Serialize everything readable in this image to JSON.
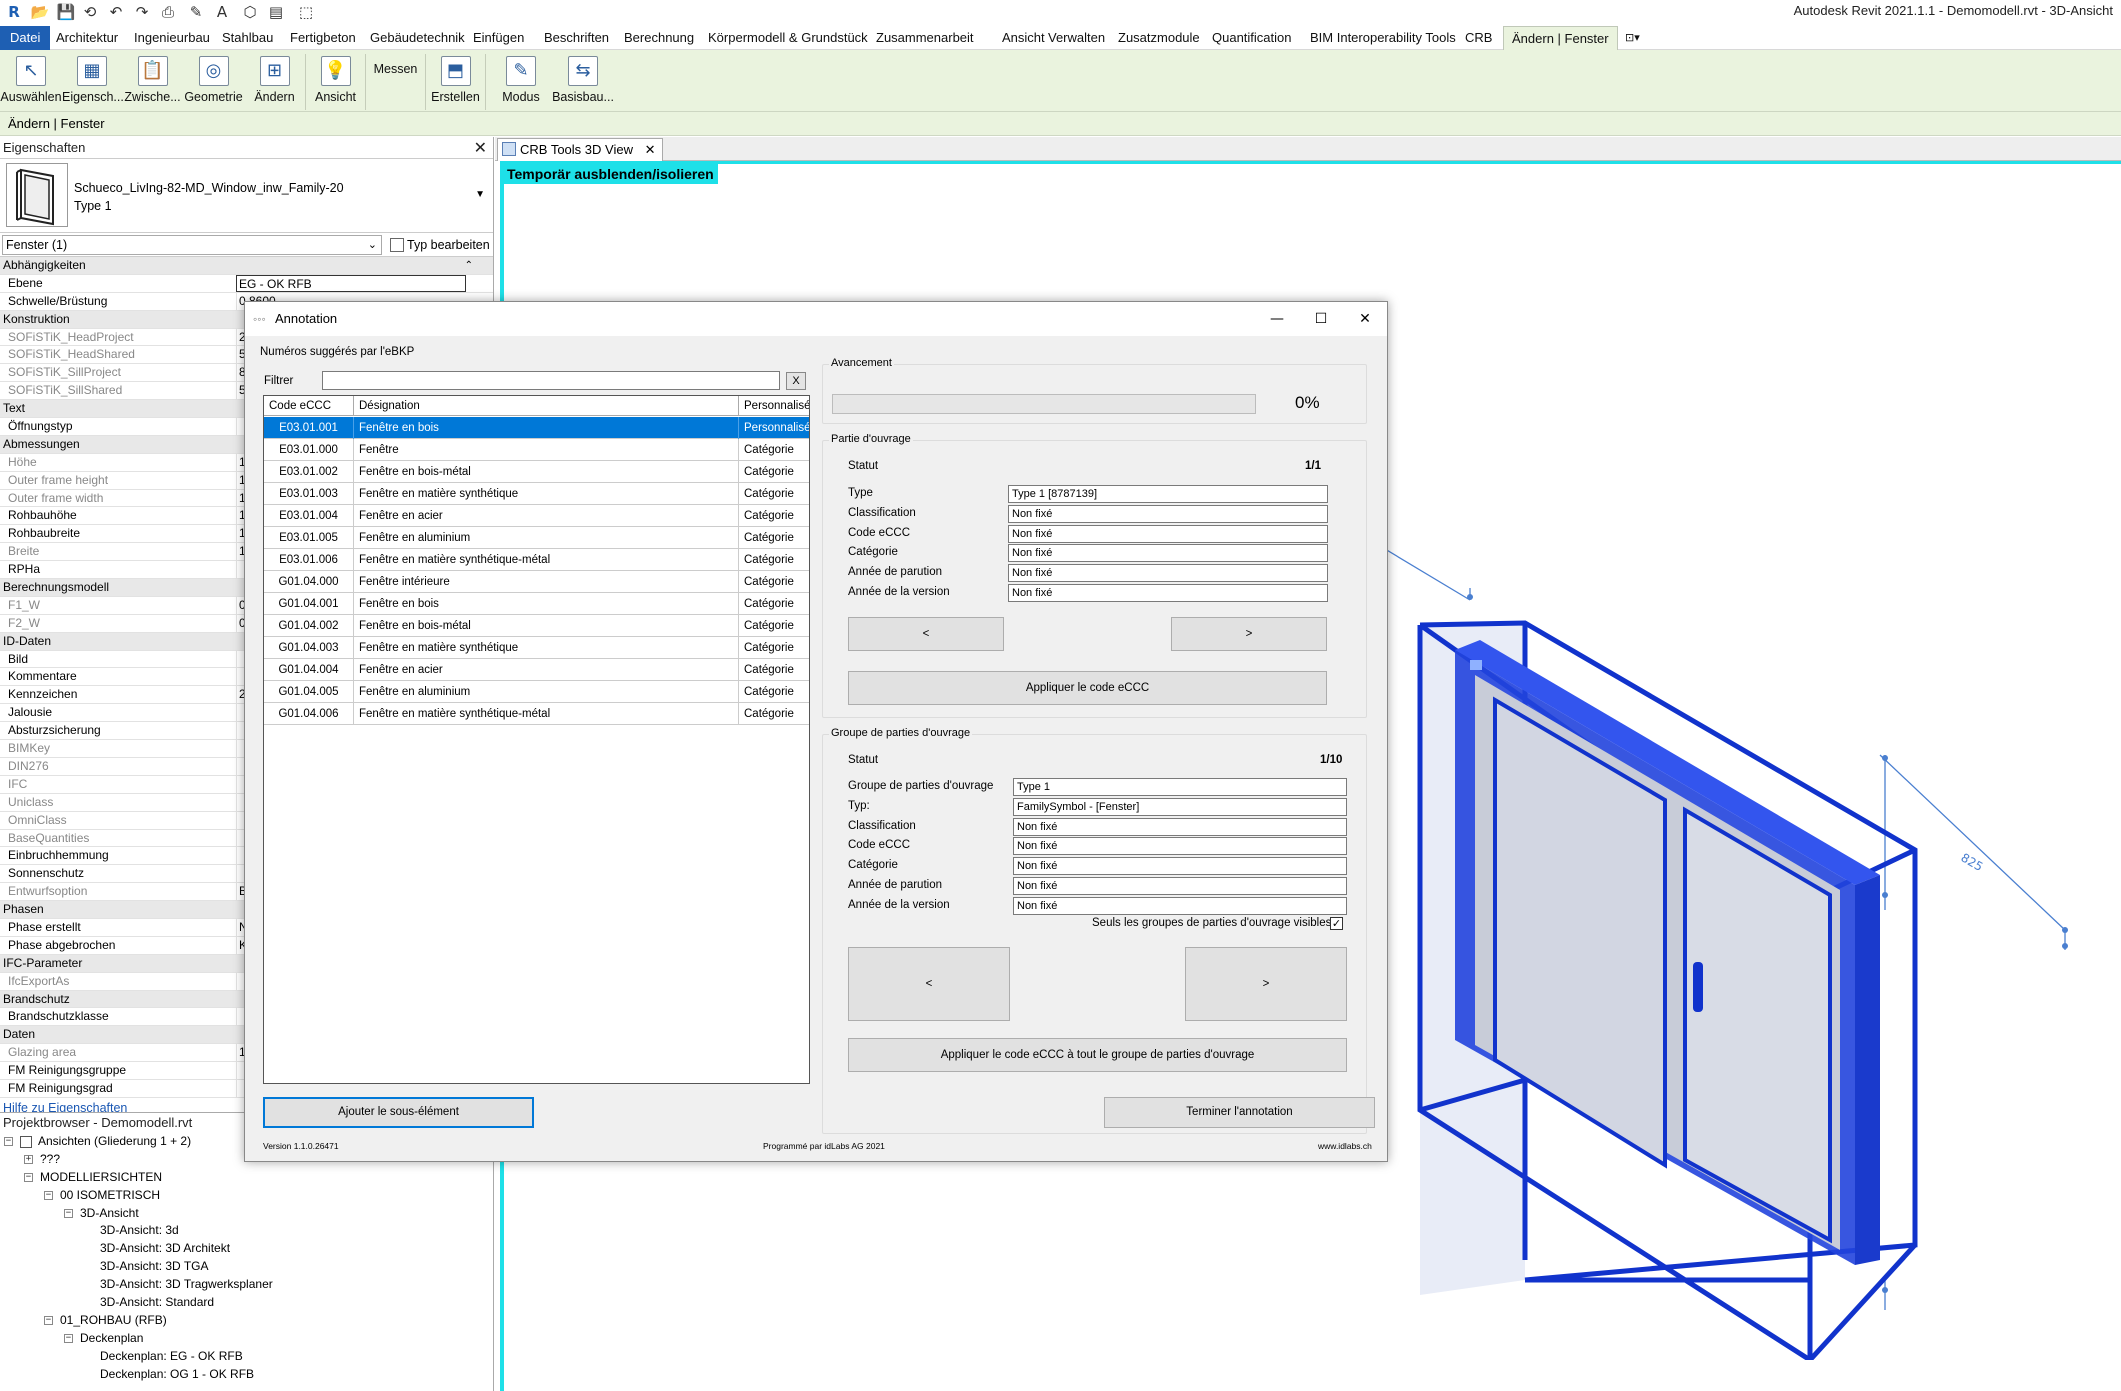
{
  "app": {
    "title": "Autodesk Revit 2021.1.1 - Demomodell.rvt - 3D-Ansicht"
  },
  "quick_access": [
    "R",
    "📂",
    "💾",
    "⟲",
    "↶",
    "↷",
    "⎙",
    "✎",
    "A",
    "⬡",
    "▤",
    "⬚"
  ],
  "ribbon_tabs": [
    {
      "label": "Datei"
    },
    {
      "label": "Architektur"
    },
    {
      "label": "Ingenieurbau"
    },
    {
      "label": "Stahlbau"
    },
    {
      "label": "Fertigbeton"
    },
    {
      "label": "Gebäudetechnik"
    },
    {
      "label": "Einfügen"
    },
    {
      "label": "Beschriften"
    },
    {
      "label": "Berechnung"
    },
    {
      "label": "Körpermodell & Grundstück"
    },
    {
      "label": "Zusammenarbeit"
    },
    {
      "label": "Ansicht"
    },
    {
      "label": "Verwalten"
    },
    {
      "label": "Zusatzmodule"
    },
    {
      "label": "Quantification"
    },
    {
      "label": "BIM Interoperability Tools"
    },
    {
      "label": "CRB"
    },
    {
      "label": "Ändern | Fenster"
    }
  ],
  "ribbon_buttons": [
    {
      "label": "Auswählen",
      "icon": "cursor-icon",
      "glyph": "↖"
    },
    {
      "label": "Eigensch...",
      "icon": "properties-icon",
      "glyph": "▦"
    },
    {
      "label": "Zwische...",
      "icon": "clipboard-icon",
      "glyph": "📋"
    },
    {
      "label": "Geometrie",
      "icon": "geometry-icon",
      "glyph": "◎"
    },
    {
      "label": "Ändern",
      "icon": "modify-icon",
      "glyph": "⊞"
    },
    {
      "label": "Ansicht",
      "icon": "lightbulb-icon",
      "glyph": "💡"
    },
    {
      "label": "Messen",
      "icon": "measure-icon",
      "glyph": ""
    },
    {
      "label": "Erstellen",
      "icon": "create-icon",
      "glyph": "⬒"
    },
    {
      "label": "Modus",
      "icon": "edit-mode-icon",
      "glyph": "✎"
    },
    {
      "label": "Basisbau...",
      "icon": "host-icon",
      "glyph": "⇆"
    }
  ],
  "context_bar": "Ändern | Fenster",
  "properties": {
    "title": "Eigenschaften",
    "type_name": "Schueco_LivIng-82-MD_Window_inw_Family-20",
    "type_sub": "Type 1",
    "filter": "Fenster (1)",
    "edit_type": "Typ bearbeiten",
    "rows": [
      {
        "label": "Abhängigkeiten",
        "group": true,
        "value": "",
        "collapse": "⌃"
      },
      {
        "label": "Ebene",
        "value": "EG - OK RFB",
        "edit": true
      },
      {
        "label": "Schwelle/Brüstung",
        "value": "0,8600"
      },
      {
        "label": "Konstruktion",
        "group": true,
        "value": ""
      },
      {
        "label": "SOFiSTiK_HeadProject",
        "dis": true,
        "value": "2"
      },
      {
        "label": "SOFiSTiK_HeadShared",
        "dis": true,
        "value": "5"
      },
      {
        "label": "SOFiSTiK_SillProject",
        "dis": true,
        "value": "8"
      },
      {
        "label": "SOFiSTiK_SillShared",
        "dis": true,
        "value": "5"
      },
      {
        "label": "Text",
        "group": true,
        "value": ""
      },
      {
        "label": "Öffnungstyp",
        "value": ""
      },
      {
        "label": "Abmessungen",
        "group": true,
        "value": ""
      },
      {
        "label": "Höhe",
        "dis": true,
        "value": "1"
      },
      {
        "label": "Outer frame height",
        "dis": true,
        "value": "1"
      },
      {
        "label": "Outer frame width",
        "dis": true,
        "value": "1"
      },
      {
        "label": "Rohbauhöhe",
        "value": "1"
      },
      {
        "label": "Rohbaubreite",
        "value": "1"
      },
      {
        "label": "Breite",
        "dis": true,
        "value": "1"
      },
      {
        "label": "RPHa",
        "value": ""
      },
      {
        "label": "Berechnungsmodell",
        "group": true,
        "value": ""
      },
      {
        "label": "F1_W",
        "dis": true,
        "value": "0"
      },
      {
        "label": "F2_W",
        "dis": true,
        "value": "0"
      },
      {
        "label": "ID-Daten",
        "group": true,
        "value": ""
      },
      {
        "label": "Bild",
        "value": ""
      },
      {
        "label": "Kommentare",
        "value": ""
      },
      {
        "label": "Kennzeichen",
        "value": "2"
      },
      {
        "label": "Jalousie",
        "value": ""
      },
      {
        "label": "Absturzsicherung",
        "value": ""
      },
      {
        "label": "BIMKey",
        "dis": true,
        "value": ""
      },
      {
        "label": "DIN276",
        "dis": true,
        "value": ""
      },
      {
        "label": "IFC",
        "dis": true,
        "value": ""
      },
      {
        "label": "Uniclass",
        "dis": true,
        "value": ""
      },
      {
        "label": "OmniClass",
        "dis": true,
        "value": ""
      },
      {
        "label": "BaseQuantities",
        "dis": true,
        "value": ""
      },
      {
        "label": "Einbruchhemmung",
        "value": ""
      },
      {
        "label": "Sonnenschutz",
        "value": ""
      },
      {
        "label": "Entwurfsoption",
        "dis": true,
        "value": "B"
      },
      {
        "label": "Phasen",
        "group": true,
        "value": ""
      },
      {
        "label": "Phase erstellt",
        "value": "N"
      },
      {
        "label": "Phase abgebrochen",
        "value": "K"
      },
      {
        "label": "IFC-Parameter",
        "group": true,
        "value": ""
      },
      {
        "label": "IfcExportAs",
        "dis": true,
        "value": ""
      },
      {
        "label": "Brandschutz",
        "group": true,
        "value": ""
      },
      {
        "label": "Brandschutzklasse",
        "value": ""
      },
      {
        "label": "Daten",
        "group": true,
        "value": ""
      },
      {
        "label": "Glazing area",
        "dis": true,
        "value": "1"
      },
      {
        "label": "FM Reinigungsgruppe",
        "value": ""
      },
      {
        "label": "FM Reinigungsgrad",
        "value": ""
      }
    ],
    "help_link": "Hilfe zu Eigenschaften"
  },
  "browser": {
    "title": "Projektbrowser - Demomodell.rvt",
    "items": [
      {
        "label": "Ansichten (Gliederung 1 + 2)",
        "level": 0,
        "toggle": "−",
        "icon": true
      },
      {
        "label": "???",
        "level": 1,
        "toggle": "+"
      },
      {
        "label": "MODELLIERSICHTEN",
        "level": 1,
        "toggle": "−"
      },
      {
        "label": "00 ISOMETRISCH",
        "level": 2,
        "toggle": "−"
      },
      {
        "label": "3D-Ansicht",
        "level": 3,
        "toggle": "−"
      },
      {
        "label": "3D-Ansicht: 3d",
        "level": 4,
        "toggle": ""
      },
      {
        "label": "3D-Ansicht: 3D Architekt",
        "level": 4,
        "toggle": ""
      },
      {
        "label": "3D-Ansicht: 3D TGA",
        "level": 4,
        "toggle": ""
      },
      {
        "label": "3D-Ansicht: 3D Tragwerksplaner",
        "level": 4,
        "toggle": ""
      },
      {
        "label": "3D-Ansicht: Standard",
        "level": 4,
        "toggle": ""
      },
      {
        "label": "01_ROHBAU (RFB)",
        "level": 2,
        "toggle": "−"
      },
      {
        "label": "Deckenplan",
        "level": 3,
        "toggle": "−"
      },
      {
        "label": "Deckenplan: EG - OK RFB",
        "level": 4,
        "toggle": ""
      },
      {
        "label": "Deckenplan: OG 1 - OK RFB",
        "level": 4,
        "toggle": ""
      }
    ]
  },
  "view": {
    "tab_label": "CRB Tools 3D View",
    "isolate_banner": "Temporär ausblenden/isolieren",
    "dimension": "825"
  },
  "dialog": {
    "title": "Annotation",
    "suggested_label": "Numéros suggérés par l'eBKP",
    "filter_label": "Filtrer",
    "filter_value": "",
    "filter_clear": "X",
    "columns": [
      "Code eCCC",
      "Désignation",
      "Personnalisé"
    ],
    "rows": [
      {
        "code": "E03.01.001",
        "name": "Fenêtre en bois",
        "kind": "Personnalisé",
        "selected": true
      },
      {
        "code": "E03.01.000",
        "name": "Fenêtre",
        "kind": "Catégorie"
      },
      {
        "code": "E03.01.002",
        "name": "Fenêtre en bois-métal",
        "kind": "Catégorie"
      },
      {
        "code": "E03.01.003",
        "name": "Fenêtre en matière synthétique",
        "kind": "Catégorie"
      },
      {
        "code": "E03.01.004",
        "name": "Fenêtre en acier",
        "kind": "Catégorie"
      },
      {
        "code": "E03.01.005",
        "name": "Fenêtre en aluminium",
        "kind": "Catégorie"
      },
      {
        "code": "E03.01.006",
        "name": "Fenêtre en matière synthétique-métal",
        "kind": "Catégorie"
      },
      {
        "code": "G01.04.000",
        "name": "Fenêtre intérieure",
        "kind": "Catégorie"
      },
      {
        "code": "G01.04.001",
        "name": "Fenêtre en bois",
        "kind": "Catégorie"
      },
      {
        "code": "G01.04.002",
        "name": "Fenêtre en bois-métal",
        "kind": "Catégorie"
      },
      {
        "code": "G01.04.003",
        "name": "Fenêtre en matière synthétique",
        "kind": "Catégorie"
      },
      {
        "code": "G01.04.004",
        "name": "Fenêtre en acier",
        "kind": "Catégorie"
      },
      {
        "code": "G01.04.005",
        "name": "Fenêtre en aluminium",
        "kind": "Catégorie"
      },
      {
        "code": "G01.04.006",
        "name": "Fenêtre en matière synthétique-métal",
        "kind": "Catégorie"
      }
    ],
    "progress": {
      "label": "Avancement",
      "percent": 0,
      "text": "0%"
    },
    "element": {
      "group_label": "Partie d'ouvrage",
      "status_label": "Statut",
      "status": "1/1",
      "fields": [
        {
          "label": "Type",
          "value": "Type 1 [8787139]"
        },
        {
          "label": "Classification",
          "value": "Non fixé"
        },
        {
          "label": "Code eCCC",
          "value": "Non fixé"
        },
        {
          "label": "Catégorie",
          "value": "Non fixé"
        },
        {
          "label": "Année de parution",
          "value": "Non fixé"
        },
        {
          "label": "Année de la version",
          "value": "Non fixé"
        }
      ],
      "prev": "<",
      "next": ">",
      "apply": "Appliquer le code eCCC"
    },
    "group": {
      "group_label": "Groupe de parties d'ouvrage",
      "status_label": "Statut",
      "status": "1/10",
      "fields": [
        {
          "label": "Groupe de parties d'ouvrage",
          "value": "Type 1"
        },
        {
          "label": "Typ:",
          "value": "FamilySymbol - [Fenster]"
        },
        {
          "label": "Classification",
          "value": "Non fixé"
        },
        {
          "label": "Code eCCC",
          "value": "Non fixé"
        },
        {
          "label": "Catégorie",
          "value": "Non fixé"
        },
        {
          "label": "Année de parution",
          "value": "Non fixé"
        },
        {
          "label": "Année de la version",
          "value": "Non fixé"
        }
      ],
      "visible_only_label": "Seuls les groupes de parties d'ouvrage visibles",
      "visible_only": true,
      "prev": "<",
      "next": ">",
      "apply": "Appliquer le code eCCC à tout le groupe de parties d'ouvrage"
    },
    "add_sub": "Ajouter le sous-élément",
    "finish": "Terminer l'annotation",
    "version": "Version 1.1.0.26471",
    "programmer": "Programmé par idLabs AG 2021",
    "website": "www.idlabs.ch"
  }
}
